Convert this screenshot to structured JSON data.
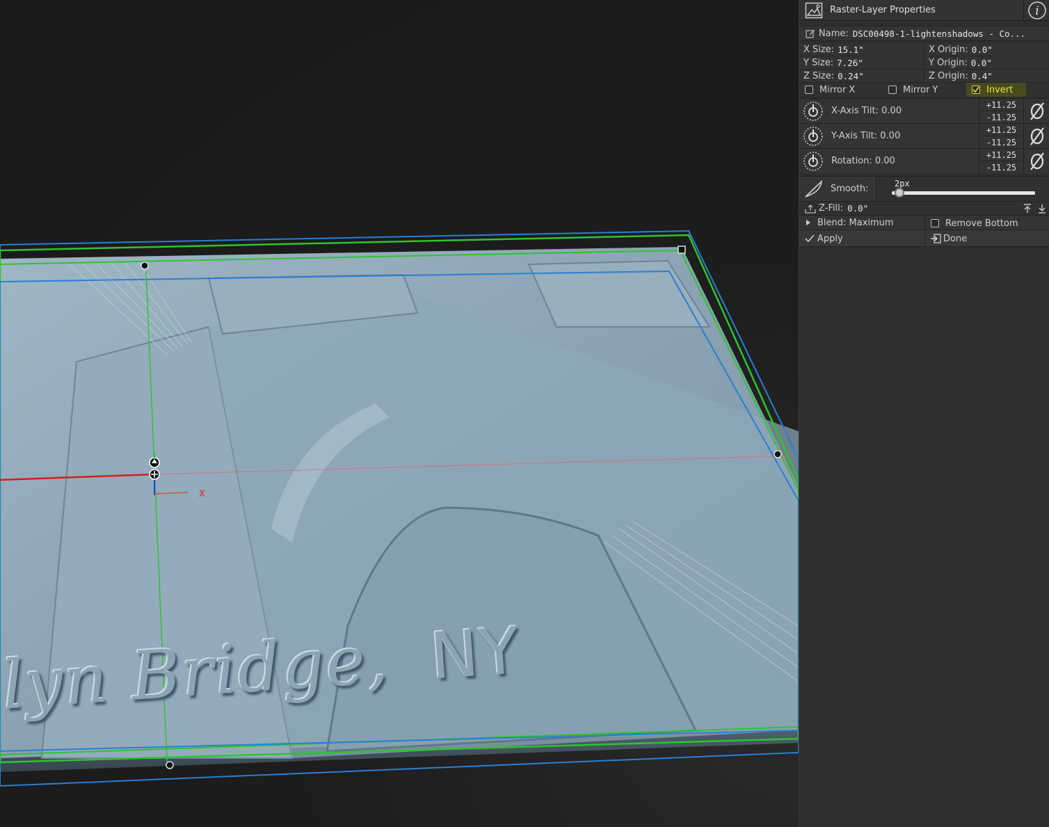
{
  "panel": {
    "title": "Raster-Layer Properties",
    "name_label": "Name:",
    "name_value": "DSC00498-1-lightenshadows - Co...",
    "x_size_label": "X Size:",
    "x_size_value": "15.1\"",
    "y_size_label": "Y Size:",
    "y_size_value": "7.26\"",
    "z_size_label": "Z Size:",
    "z_size_value": "0.24\"",
    "x_origin_label": "X Origin:",
    "x_origin_value": "0.0\"",
    "y_origin_label": "Y Origin:",
    "y_origin_value": "0.0\"",
    "z_origin_label": "Z Origin:",
    "z_origin_value": "0.4\"",
    "mirror_x": {
      "label": "Mirror X",
      "checked": false
    },
    "mirror_y": {
      "label": "Mirror Y",
      "checked": false
    },
    "invert": {
      "label": "Invert",
      "checked": true
    },
    "x_tilt": {
      "label": "X-Axis Tilt: 0.00",
      "plus": "+11.25",
      "minus": "-11.25"
    },
    "y_tilt": {
      "label": "Y-Axis Tilt: 0.00",
      "plus": "+11.25",
      "minus": "-11.25"
    },
    "rotation": {
      "label": "Rotation: 0.00",
      "plus": "+11.25",
      "minus": "-11.25"
    },
    "smooth_label": "Smooth:",
    "smooth_value": "2px",
    "zfill_label": "Z-Fill:",
    "zfill_value": "0.0\"",
    "blend_label": "Blend: Maximum",
    "remove_bottom": {
      "label": "Remove Bottom",
      "checked": false
    },
    "apply_label": "Apply",
    "done_label": "Done"
  },
  "viewport": {
    "relief_text_1": "lyn Bridge,",
    "relief_text_2": "NY",
    "axis_label_x": "X"
  },
  "colors": {
    "panel_bg": "#2e2e2e",
    "viewport_bg": "#1a1a1a",
    "relief": "#8ea4b3",
    "box_green": "#2ec42e",
    "box_blue": "#2a7fd4",
    "axis_red": "#d02020",
    "invert_highlight": "#e6e63a"
  }
}
